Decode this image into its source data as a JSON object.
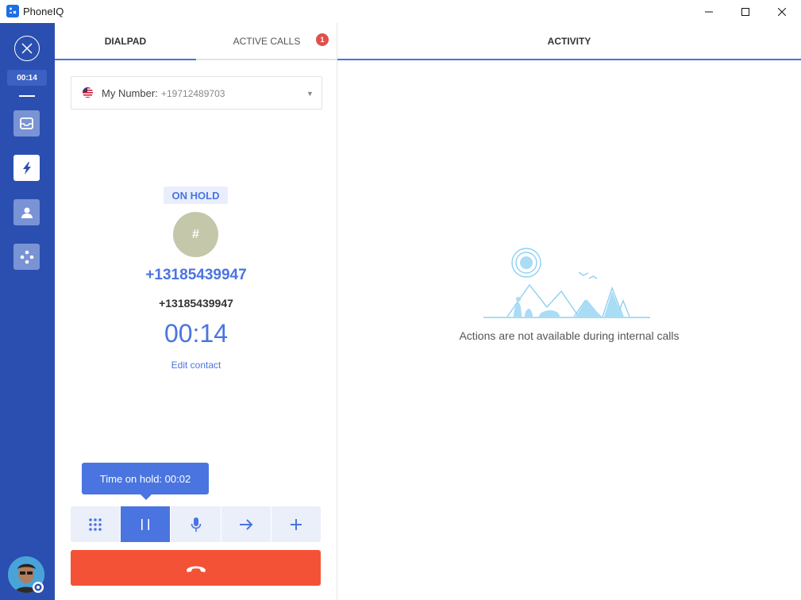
{
  "window": {
    "title": "PhoneIQ"
  },
  "rail": {
    "timer": "00:14"
  },
  "tabs": {
    "dialpad": "DIALPAD",
    "active_calls": "ACTIVE CALLS",
    "active_calls_count": "1",
    "activity": "ACTIVITY"
  },
  "number_select": {
    "label": "My Number:",
    "value": "+19712489703"
  },
  "call": {
    "status": "ON HOLD",
    "avatar_initial": "#",
    "number_primary": "+13185439947",
    "number_secondary": "+13185439947",
    "timer": "00:14",
    "edit_contact": "Edit contact"
  },
  "tooltip": {
    "text": "Time on hold: 00:02"
  },
  "activity": {
    "empty_message": "Actions are not available during internal calls"
  },
  "colors": {
    "rail": "#2a4fb0",
    "accent": "#4a74e0",
    "hangup": "#f45236",
    "badge": "#e0514b"
  }
}
